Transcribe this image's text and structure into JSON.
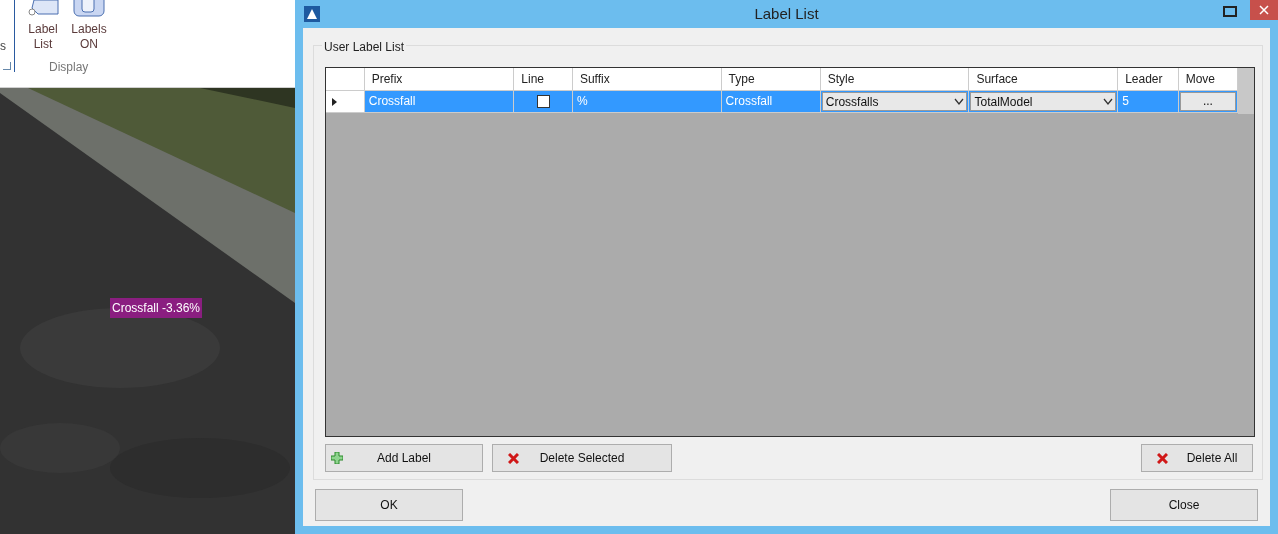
{
  "ribbon": {
    "cut_text": "s",
    "buttons": [
      {
        "label": "Label List",
        "kind": "tag"
      },
      {
        "label": "Labels ON",
        "kind": "toggle"
      }
    ],
    "group_label": "Display"
  },
  "viewport": {
    "kind": "picture",
    "label": "Crossfall -3.36%"
  },
  "dialog": {
    "title": "Label List",
    "group_title": "User Label List",
    "table": {
      "columns": [
        "Prefix",
        "Line",
        "Suffix",
        "Type",
        "Style",
        "Surface",
        "Leader",
        "Move"
      ],
      "rows": [
        {
          "selected": true,
          "prefix": "Crossfall",
          "line": false,
          "suffix": "%",
          "type": "Crossfall",
          "style": "Crossfalls",
          "surface": "TotalModel",
          "leader": "5",
          "move": "..."
        }
      ]
    },
    "actions": [
      {
        "label": "Add Label",
        "kind": "add"
      },
      {
        "label": "Delete Selected",
        "kind": "delete"
      },
      {
        "label": "Delete All",
        "kind": "delete"
      }
    ],
    "footer": [
      "OK",
      "Close"
    ]
  }
}
